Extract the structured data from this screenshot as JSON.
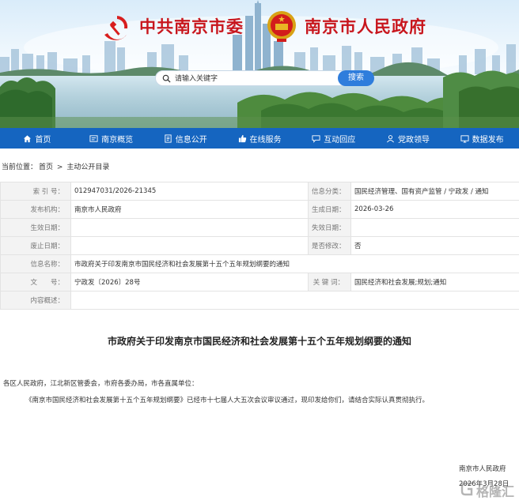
{
  "header": {
    "title_left": "中共南京市委",
    "title_right": "南京市人民政府",
    "search_placeholder": "请输入关键字",
    "search_button": "搜索"
  },
  "nav": {
    "items": [
      {
        "label": "首页",
        "icon": "home-icon"
      },
      {
        "label": "南京概览",
        "icon": "overview-icon"
      },
      {
        "label": "信息公开",
        "icon": "document-icon"
      },
      {
        "label": "在线服务",
        "icon": "thumbs-up-icon"
      },
      {
        "label": "互动回应",
        "icon": "chat-icon"
      },
      {
        "label": "党政领导",
        "icon": "leader-icon"
      },
      {
        "label": "数据发布",
        "icon": "data-icon"
      }
    ]
  },
  "breadcrumb": {
    "prefix": "当前位置：",
    "home": "首页",
    "separator": ">",
    "current": "主动公开目录"
  },
  "info": {
    "index_label": "索 引 号：",
    "index_value": "012947031/2026-21345",
    "category_label": "信息分类：",
    "category_value": "国民经济管理、国有资产监管 / 宁政发 / 通知",
    "publisher_label": "发布机构：",
    "publisher_value": "南京市人民政府",
    "created_label": "生成日期：",
    "created_value": "2026-03-26",
    "effective_label": "生效日期：",
    "effective_value": "",
    "expire_label": "失效日期：",
    "expire_value": "",
    "abolish_label": "废止日期：",
    "abolish_value": "",
    "modified_label": "是否修改：",
    "modified_value": "否",
    "name_label": "信息名称：",
    "name_value": "市政府关于印发南京市国民经济和社会发展第十五个五年规划纲要的通知",
    "docno_label": "文　　号：",
    "docno_value": "宁政发〔2026〕28号",
    "keywords_label": "关 键 词：",
    "keywords_value": "国民经济和社会发展;规划;通知",
    "summary_label": "内容概述：",
    "summary_value": ""
  },
  "article": {
    "title": "市政府关于印发南京市国民经济和社会发展第十五个五年规划纲要的通知",
    "addressee": "各区人民政府，江北新区管委会，市府各委办局，市各直属单位：",
    "body": "《南京市国民经济和社会发展第十五个五年规划纲要》已经市十七届人大五次会议审议通过，现印发给你们，请结合实际认真贯彻执行。",
    "signature": "南京市人民政府",
    "date": "2026年3月28日"
  },
  "watermark": {
    "text": "格隆汇"
  },
  "colors": {
    "nav_bg": "#1565c0",
    "title_red": "#c8161d",
    "search_button": "#2f7ddc",
    "label_bg": "#f3f3f3"
  }
}
